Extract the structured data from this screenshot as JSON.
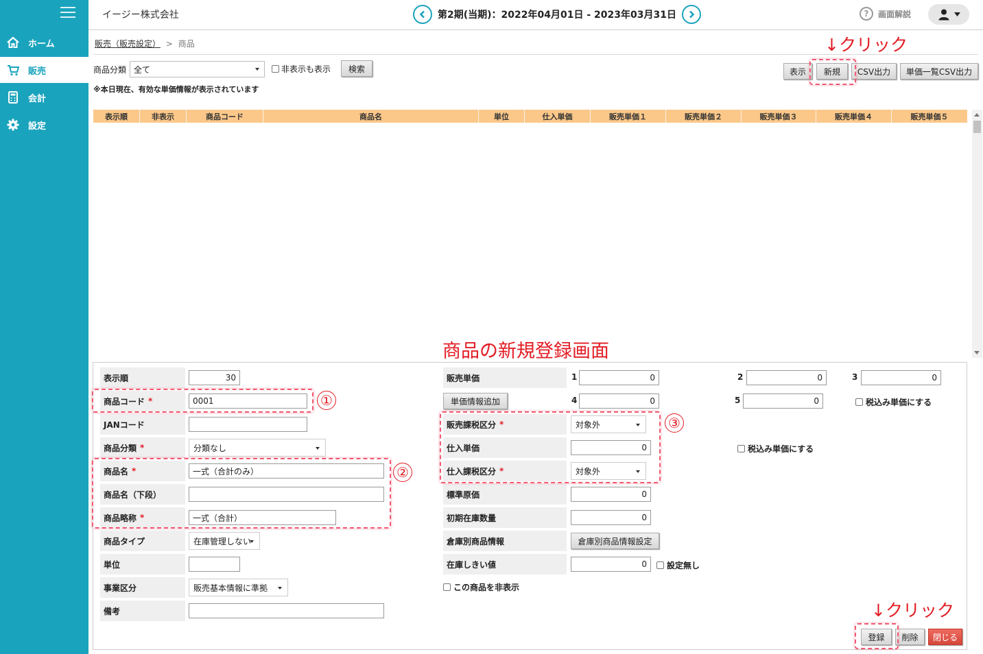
{
  "sidebar": {
    "items": [
      {
        "label": "ホーム",
        "icon": "home-icon"
      },
      {
        "label": "販売",
        "icon": "cart-icon"
      },
      {
        "label": "会計",
        "icon": "calculator-icon"
      },
      {
        "label": "設定",
        "icon": "gear-icon"
      }
    ],
    "active": "販売"
  },
  "header": {
    "company": "イージー株式会社",
    "period": "第2期(当期)：2022年04月01日 - 2023年03月31日",
    "help_label": "画面解説"
  },
  "breadcrumb": {
    "parent": "販売（販売設定）",
    "separator": ">",
    "current": "商品"
  },
  "filter": {
    "category_label": "商品分類",
    "category_value": "全て",
    "show_hidden_label": "非表示も表示",
    "search_button": "検索",
    "note": "※本日現在、有効な単価情報が表示されています"
  },
  "toolbar": {
    "show": "表示",
    "new": "新規",
    "csv": "CSV出力",
    "price_csv": "単価一覧CSV出力"
  },
  "table": {
    "columns": [
      "表示順",
      "非表示",
      "商品コード",
      "商品名",
      "単位",
      "仕入単価",
      "販売単価１",
      "販売単価２",
      "販売単価３",
      "販売単価４",
      "販売単価５"
    ],
    "rows": []
  },
  "annotations": {
    "title": "商品の新規登録画面",
    "click_top": "↓クリック",
    "click_bottom": "↓クリック",
    "n1": "①",
    "n2": "②",
    "n3": "③",
    "color": "#e21c24"
  },
  "form": {
    "left": {
      "display_order": {
        "label": "表示順",
        "value": "30"
      },
      "code": {
        "label": "商品コード",
        "value": "0001"
      },
      "jan": {
        "label": "JANコード",
        "value": ""
      },
      "category": {
        "label": "商品分類",
        "value": "分類なし"
      },
      "name": {
        "label": "商品名",
        "value": "一式（合計のみ）"
      },
      "name_lower": {
        "label": "商品名（下段）",
        "value": ""
      },
      "short_name": {
        "label": "商品略称",
        "value": "一式（合計）"
      },
      "type": {
        "label": "商品タイプ",
        "value": "在庫管理しない"
      },
      "unit": {
        "label": "単位",
        "value": ""
      },
      "business": {
        "label": "事業区分",
        "value": "販売基本情報に準拠"
      },
      "remarks": {
        "label": "備考",
        "value": ""
      }
    },
    "right": {
      "sale_price": {
        "label": "販売単価",
        "p1": "0",
        "p2": "0",
        "p3": "0",
        "p4": "0",
        "p5": "0",
        "i1": "1",
        "i2": "2",
        "i3": "3",
        "i4": "4",
        "i5": "5"
      },
      "add_price_button": "単価情報追加",
      "tax_included_sale": "税込み単価にする",
      "sale_tax": {
        "label": "販売課税区分",
        "value": "対象外"
      },
      "purchase_price": {
        "label": "仕入単価",
        "value": "0"
      },
      "tax_included_purchase": "税込み単価にする",
      "purchase_tax": {
        "label": "仕入課税区分",
        "value": "対象外"
      },
      "standard_cost": {
        "label": "標準原価",
        "value": "0"
      },
      "initial_stock": {
        "label": "初期在庫数量",
        "value": "0"
      },
      "warehouse": {
        "label": "倉庫別商品情報",
        "button": "倉庫別商品情報設定"
      },
      "threshold": {
        "label": "在庫しきい値",
        "value": "0",
        "no_setting": "設定無し"
      },
      "hide_product": "この商品を非表示"
    },
    "buttons": {
      "register": "登録",
      "delete": "削除",
      "close": "閉じる"
    }
  }
}
